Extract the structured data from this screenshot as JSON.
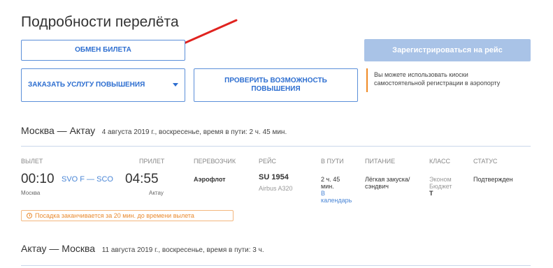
{
  "page_title": "Подробности перелёта",
  "buttons": {
    "exchange": "ОБМЕН БИЛЕТА",
    "register": "Зарегистрироваться на рейс",
    "upgrade": "ЗАКАЗАТЬ УСЛУГУ ПОВЫШЕНИЯ",
    "check_line1": "ПРОВЕРИТЬ ВОЗМОЖНОСТЬ",
    "check_line2": "ПОВЫШЕНИЯ"
  },
  "kiosk_note": {
    "line1": "Вы можете использовать киоски",
    "line2": "самостоятельной регистрации в аэропорту"
  },
  "routes": [
    {
      "name": "Москва — Актау",
      "meta": "4 августа 2019 г., воскресенье, время в пути: 2 ч. 45 мин."
    },
    {
      "name": "Актау — Москва",
      "meta": "11 августа 2019 г., воскресенье, время в пути: 3 ч."
    }
  ],
  "columns": {
    "departure": "ВЫЛЕТ",
    "arrival": "ПРИЛЕТ",
    "carrier": "ПЕРЕВОЗЧИК",
    "flight": "РЕЙС",
    "duration": "В ПУТИ",
    "meal": "ПИТАНИЕ",
    "class": "КЛАСС",
    "status": "СТАТУС"
  },
  "segment": {
    "dep_time": "00:10",
    "airports": "SVO F — SCO",
    "arr_time": "04:55",
    "dep_city": "Москва",
    "arr_city": "Актау",
    "carrier": "Аэрофлот",
    "flight_no": "SU 1954",
    "aircraft": "Airbus A320",
    "duration_line1": "2 ч. 45",
    "duration_line2": "мин.",
    "calendar_line1": "В",
    "calendar_line2": "календарь",
    "meal_line1": "Лёгкая закуска/",
    "meal_line2": "сэндвич",
    "class_line1": "Эконом",
    "class_line2": "Бюджет",
    "class_code": "T",
    "status": "Подтвержден"
  },
  "boarding_notice": "Посадка заканчивается за 20 мин. до времени вылета",
  "colors": {
    "accent_blue": "#2d6ed0",
    "register_disabled": "#a9c3e7",
    "warning_orange": "#e98a2f",
    "annotation_red": "#e0231f"
  },
  "icons": {
    "annotation": "red-arrow",
    "upgrade_dropdown": "chevron-down-icon",
    "boarding": "clock-icon"
  }
}
